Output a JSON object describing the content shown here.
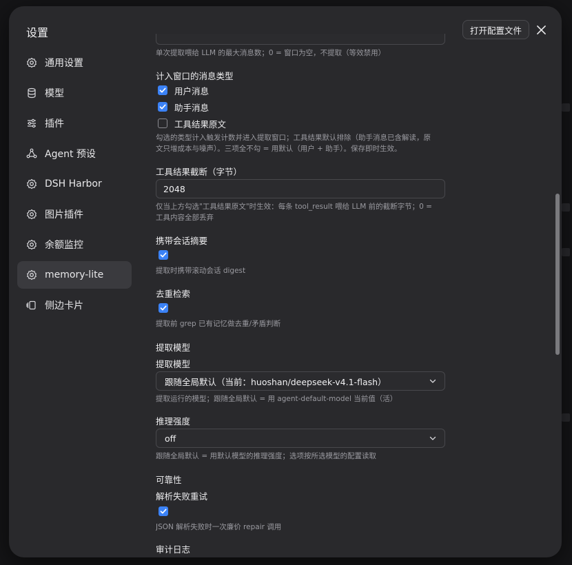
{
  "dialog": {
    "title": "设置",
    "open_config_label": "打开配置文件"
  },
  "sidebar": {
    "items": [
      {
        "label": "通用设置",
        "icon": "gear-icon"
      },
      {
        "label": "模型",
        "icon": "database-icon"
      },
      {
        "label": "插件",
        "icon": "sliders-icon"
      },
      {
        "label": "Agent 预设",
        "icon": "nodes-icon"
      },
      {
        "label": "DSH Harbor",
        "icon": "gear-icon"
      },
      {
        "label": "图片插件",
        "icon": "gear-icon"
      },
      {
        "label": "余额监控",
        "icon": "gear-icon"
      },
      {
        "label": "memory-lite",
        "icon": "gear-icon",
        "active": true
      },
      {
        "label": "侧边卡片",
        "icon": "cards-icon"
      }
    ]
  },
  "content": {
    "max_messages_hint": "单次提取喂给 LLM 的最大消息数；0 = 窗口为空，不提取（等效禁用）",
    "msg_types": {
      "title": "计入窗口的消息类型",
      "options": [
        {
          "label": "用户消息",
          "checked": true
        },
        {
          "label": "助手消息",
          "checked": true
        },
        {
          "label": "工具结果原文",
          "checked": false
        }
      ],
      "hint_line1": "勾选的类型计入触发计数并进入提取窗口；工具结果默认排除（助手消息已含解读，原",
      "hint_line2": "文只增成本与噪声）。三项全不勾 = 用默认（用户 + 助手）。保存即时生效。"
    },
    "tool_truncate": {
      "label": "工具结果截断（字节）",
      "value": "2048",
      "hint_line1": "仅当上方勾选\"工具结果原文\"时生效：每条 tool_result 喂给 LLM 前的截断字节；0 =",
      "hint_line2": "工具内容全部丢弃"
    },
    "digest": {
      "label": "携带会话摘要",
      "checked": true,
      "hint": "提取时携带滚动会话 digest"
    },
    "dedup": {
      "label": "去重检索",
      "checked": true,
      "hint": "提取前 grep 已有记忆做去重/矛盾判断"
    },
    "extract_model_section": "提取模型",
    "extract_model": {
      "label": "提取模型",
      "value": "跟随全局默认（当前：huoshan/deepseek-v4.1-flash）",
      "hint": "提取运行的模型；跟随全局默认 = 用 agent-default-model 当前值（活）"
    },
    "reasoning": {
      "label": "推理强度",
      "value": "off",
      "hint": "跟随全局默认 = 用默认模型的推理强度；选项按所选模型的配置读取"
    },
    "reliability_section": "可靠性",
    "retry": {
      "label": "解析失败重试",
      "checked": true,
      "hint": "JSON 解析失败时一次廉价 repair 调用"
    },
    "audit_section": "审计日志"
  }
}
